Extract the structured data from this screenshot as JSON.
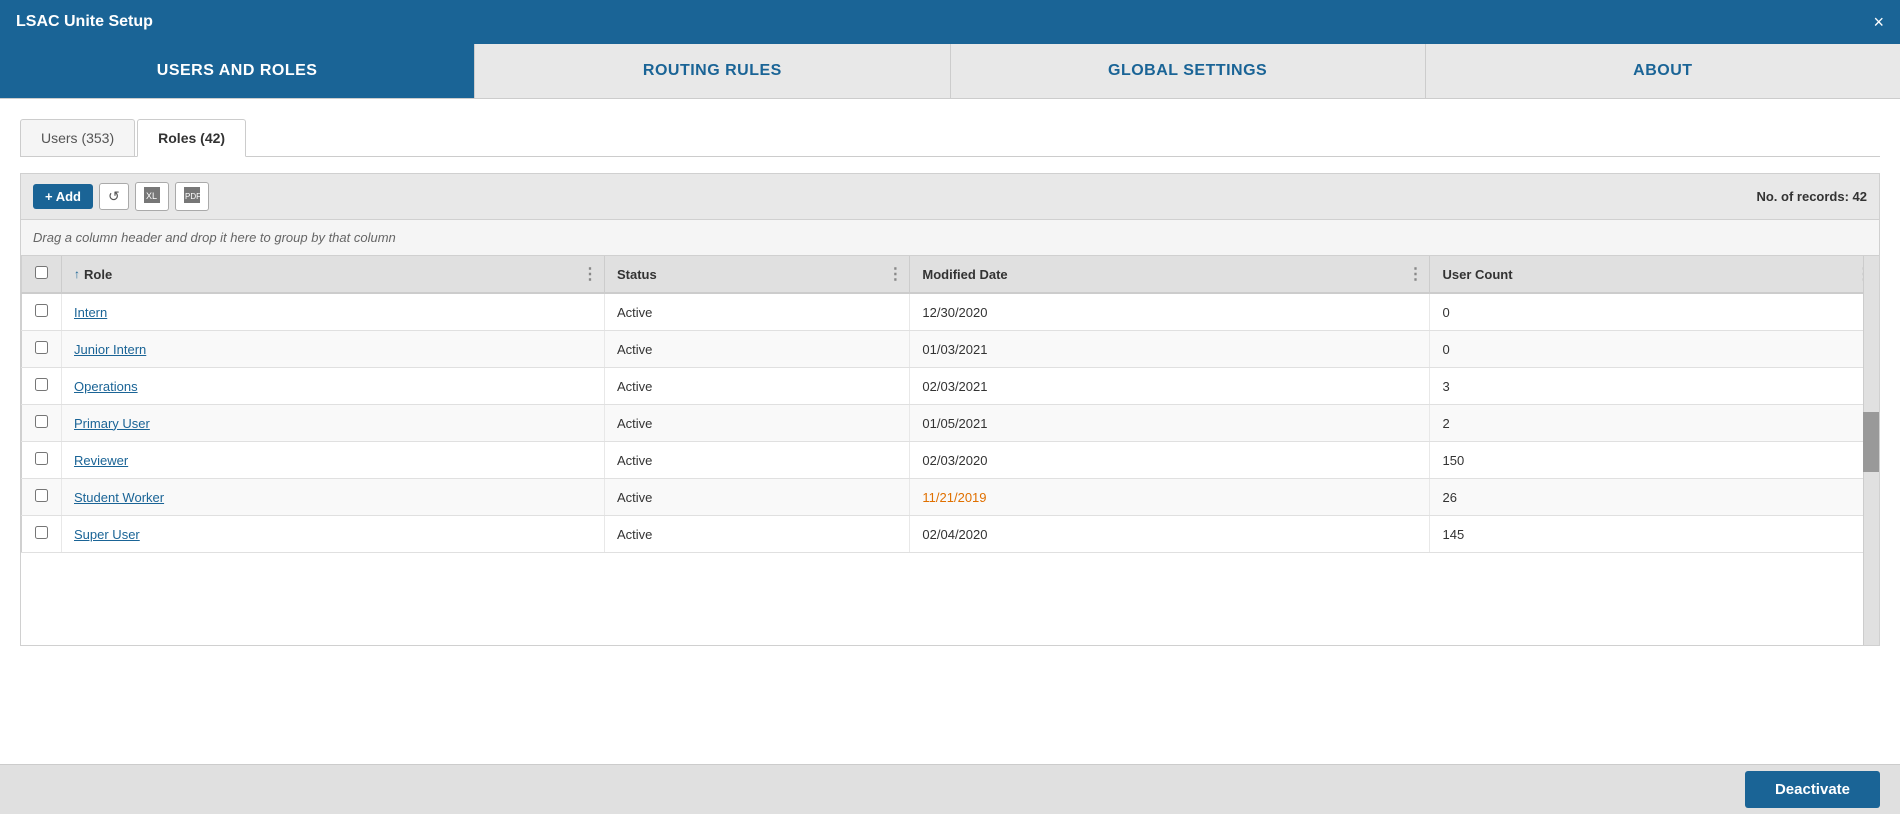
{
  "titleBar": {
    "title": "LSAC Unite Setup",
    "close": "×"
  },
  "navTabs": [
    {
      "id": "users-and-roles",
      "label": "USERS AND ROLES",
      "active": true
    },
    {
      "id": "routing-rules",
      "label": "ROUTING RULES",
      "active": false
    },
    {
      "id": "global-settings",
      "label": "GLOBAL SETTINGS",
      "active": false
    },
    {
      "id": "about",
      "label": "ABOUT",
      "active": false
    }
  ],
  "subTabs": [
    {
      "id": "users",
      "label": "Users (353)",
      "active": false
    },
    {
      "id": "roles",
      "label": "Roles (42)",
      "active": true
    }
  ],
  "toolbar": {
    "addLabel": "+ Add",
    "recordsLabel": "No. of records: 42"
  },
  "dragHint": "Drag a column header and drop it here to group by that column",
  "tableHeaders": [
    {
      "id": "role",
      "label": "Role",
      "sortArrow": "↑",
      "sortable": true
    },
    {
      "id": "status",
      "label": "Status",
      "sortable": false
    },
    {
      "id": "modifiedDate",
      "label": "Modified Date",
      "sortable": false
    },
    {
      "id": "userCount",
      "label": "User Count",
      "sortable": false
    }
  ],
  "tableRows": [
    {
      "role": "Intern",
      "status": "Active",
      "modifiedDate": "12/30/2020",
      "userCount": "0",
      "dateWarning": false
    },
    {
      "role": "Junior Intern",
      "status": "Active",
      "modifiedDate": "01/03/2021",
      "userCount": "0",
      "dateWarning": false
    },
    {
      "role": "Operations",
      "status": "Active",
      "modifiedDate": "02/03/2021",
      "userCount": "3",
      "dateWarning": false
    },
    {
      "role": "Primary User",
      "status": "Active",
      "modifiedDate": "01/05/2021",
      "userCount": "2",
      "dateWarning": false
    },
    {
      "role": "Reviewer",
      "status": "Active",
      "modifiedDate": "02/03/2020",
      "userCount": "150",
      "dateWarning": false
    },
    {
      "role": "Student Worker",
      "status": "Active",
      "modifiedDate": "11/21/2019",
      "userCount": "26",
      "dateWarning": true
    },
    {
      "role": "Super User",
      "status": "Active",
      "modifiedDate": "02/04/2020",
      "userCount": "145",
      "dateWarning": false
    }
  ],
  "bottomBar": {
    "deactivateLabel": "Deactivate"
  }
}
